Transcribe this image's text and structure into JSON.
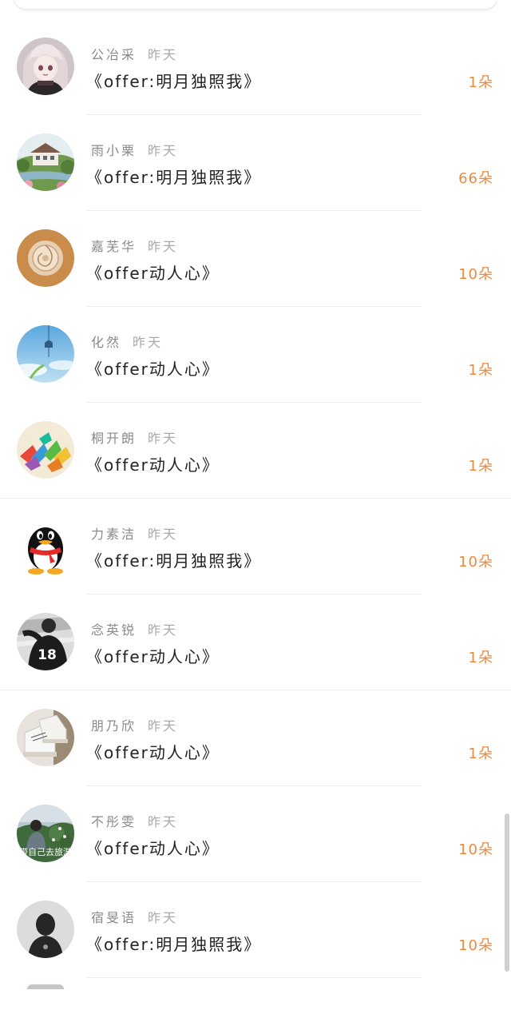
{
  "items": [
    {
      "name": "公冶采",
      "time": "昨天",
      "title": "《offer:明月独照我》",
      "count": "1朵",
      "avatar": "anime-girl-avatar"
    },
    {
      "name": "雨小栗",
      "time": "昨天",
      "title": "《offer:明月独照我》",
      "count": "66朵",
      "avatar": "house-landscape-avatar"
    },
    {
      "name": "嘉芜华",
      "time": "昨天",
      "title": "《offer动人心》",
      "count": "10朵",
      "avatar": "shell-avatar"
    },
    {
      "name": "化然",
      "time": "昨天",
      "title": "《offer动人心》",
      "count": "1朵",
      "avatar": "sky-windchime-avatar"
    },
    {
      "name": "桐开朗",
      "time": "昨天",
      "title": "《offer动人心》",
      "count": "1朵",
      "avatar": "paper-cranes-avatar"
    },
    {
      "name": "力素洁",
      "time": "昨天",
      "title": "《offer:明月独照我》",
      "count": "10朵",
      "avatar": "penguin-avatar"
    },
    {
      "name": "念英锐",
      "time": "昨天",
      "title": "《offer动人心》",
      "count": "1朵",
      "avatar": "jersey-person-avatar"
    },
    {
      "name": "朋乃欣",
      "time": "昨天",
      "title": "《offer动人心》",
      "count": "1朵",
      "avatar": "sneakers-avatar"
    },
    {
      "name": "不彤雯",
      "time": "昨天",
      "title": "《offer动人心》",
      "count": "10朵",
      "avatar": "girl-flowers-avatar"
    },
    {
      "name": "宿旻语",
      "time": "昨天",
      "title": "《offer:明月独照我》",
      "count": "10朵",
      "avatar": "silhouette-avatar"
    }
  ],
  "avatar_text": {
    "jersey_number": "18",
    "flower_photo_caption": "带自己去旅游"
  },
  "colors": {
    "count": "#ee8a3c",
    "name": "#8a8a8a",
    "title": "#222222",
    "divider": "#efefef"
  }
}
